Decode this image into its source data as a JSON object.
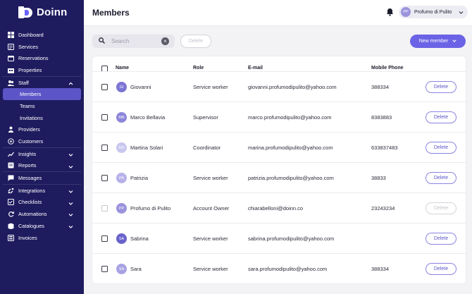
{
  "brand": {
    "name": "Doinn"
  },
  "sidebar": {
    "items": [
      {
        "label": "Dashboard",
        "icon": "dashboard-icon"
      },
      {
        "label": "Services",
        "icon": "services-icon"
      },
      {
        "label": "Reservations",
        "icon": "calendar-icon"
      },
      {
        "label": "Properties",
        "icon": "properties-icon"
      },
      {
        "label": "Staff",
        "icon": "staff-icon"
      },
      {
        "label": "Members"
      },
      {
        "label": "Teams"
      },
      {
        "label": "Invitations"
      },
      {
        "label": "Providers",
        "icon": "providers-icon"
      },
      {
        "label": "Customers",
        "icon": "customers-icon"
      },
      {
        "label": "Insights",
        "icon": "insights-icon"
      },
      {
        "label": "Reports",
        "icon": "reports-icon"
      },
      {
        "label": "Messages",
        "icon": "messages-icon"
      },
      {
        "label": "Integrations",
        "icon": "integrations-icon"
      },
      {
        "label": "Checklists",
        "icon": "checklists-icon"
      },
      {
        "label": "Automations",
        "icon": "automations-icon"
      },
      {
        "label": "Catalogues",
        "icon": "catalogues-icon"
      },
      {
        "label": "Invoices",
        "icon": "invoices-icon"
      }
    ]
  },
  "header": {
    "title": "Members",
    "user": {
      "initials": "PP",
      "name": "Profumo di Pulito"
    }
  },
  "toolbar": {
    "search_placeholder": "Search",
    "delete_label": "Delete",
    "new_member_label": "New member"
  },
  "table": {
    "columns": [
      "Name",
      "Role",
      "E-mail",
      "Mobile Phone"
    ],
    "delete_label": "Delete",
    "rows": [
      {
        "initials": "GI",
        "name": "Giovanni",
        "role": "Service worker",
        "email": "giovanni.profumodipulito@yahoo.com",
        "phone": "388334",
        "avatar_color": "#7b74d4"
      },
      {
        "initials": "MB",
        "name": "Marco Bellavia",
        "role": "Supervisor",
        "email": "marco.profumodipulito@yahoo.com",
        "phone": "8383883",
        "avatar_color": "#8c86d9"
      },
      {
        "initials": "MS",
        "name": "Martina Solari",
        "role": "Coordinator",
        "email": "marina.profumodipulito@yahoo.com",
        "phone": "633837483",
        "avatar_color": "#c9c6ef"
      },
      {
        "initials": "PA",
        "name": "Patrizia",
        "role": "Service worker",
        "email": "patrizia.profumodipulito@yahoo.com",
        "phone": "38833",
        "avatar_color": "#b6b1e8"
      },
      {
        "initials": "PP",
        "name": "Profumo di Pulito",
        "role": "Account Owner",
        "email": "chiarabelloni@doinn.co",
        "phone": "23243234",
        "avatar_color": "#9b93dc"
      },
      {
        "initials": "SA",
        "name": "Sabrina",
        "role": "Service worker",
        "email": "sabrina.profumodipulito@yahoo.com",
        "phone": "",
        "avatar_color": "#6a62cc"
      },
      {
        "initials": "SA",
        "name": "Sara",
        "role": "Service worker",
        "email": "sara.profumodipulito@yahoo.com",
        "phone": "388334",
        "avatar_color": "#a8a2e4"
      }
    ]
  }
}
